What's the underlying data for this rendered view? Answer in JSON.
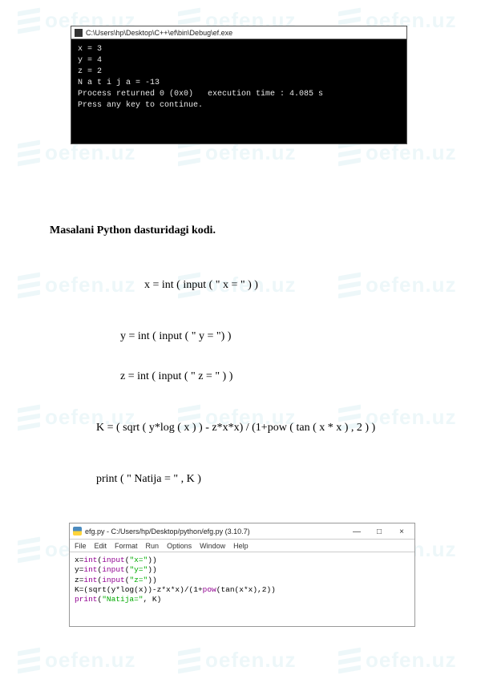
{
  "watermark": {
    "text": "oefen.uz"
  },
  "console": {
    "title": "C:\\Users\\hp\\Desktop\\C++\\ef\\bin\\Debug\\ef.exe",
    "lines": [
      "x = 3",
      "y = 4",
      "z = 2",
      "N a t i j a = -13",
      "Process returned 0 (0x0)   execution time : 4.085 s",
      "Press any key to continue."
    ]
  },
  "heading": "Masalani Python dasturidagi kodi.",
  "code": {
    "l1": "x = int ( input ( \" x = \" ) )",
    "l2": "y = int ( input ( \" y = \") )",
    "l3": "z =  int ( input ( \" z = \" ) )",
    "l4": "K = ( sqrt ( y*log ( x ) ) - z*x*x) / (1+pow ( tan ( x * x ) , 2 ) )",
    "l5": "print ( \" Natija = \" , K )"
  },
  "idle": {
    "title": "efg.py - C:/Users/hp/Desktop/python/efg.py (3.10.7)",
    "menu": [
      "File",
      "Edit",
      "Format",
      "Run",
      "Options",
      "Window",
      "Help"
    ],
    "win_btns": {
      "min": "—",
      "max": "□",
      "close": "×"
    },
    "src": {
      "l1": {
        "a": "x=",
        "b": "int",
        "c": "(",
        "d": "input",
        "e": "(",
        "f": "\"x=\"",
        "g": "))"
      },
      "l2": {
        "a": "y=",
        "b": "int",
        "c": "(",
        "d": "input",
        "e": "(",
        "f": "\"y=\"",
        "g": "))"
      },
      "l3": {
        "a": "z=",
        "b": "int",
        "c": "(",
        "d": "input",
        "e": "(",
        "f": "\"z=\"",
        "g": "))"
      },
      "l4": {
        "a": "K=(sqrt(y*log(x))-z*x*x)/(",
        "b": "1",
        "c": "+",
        "d": "pow",
        "e": "(tan(x*x),",
        "f": "2",
        "g": "))"
      },
      "l5": {
        "a": "print",
        "b": "(",
        "c": "\"Natija=\"",
        "d": ", K)"
      }
    }
  }
}
